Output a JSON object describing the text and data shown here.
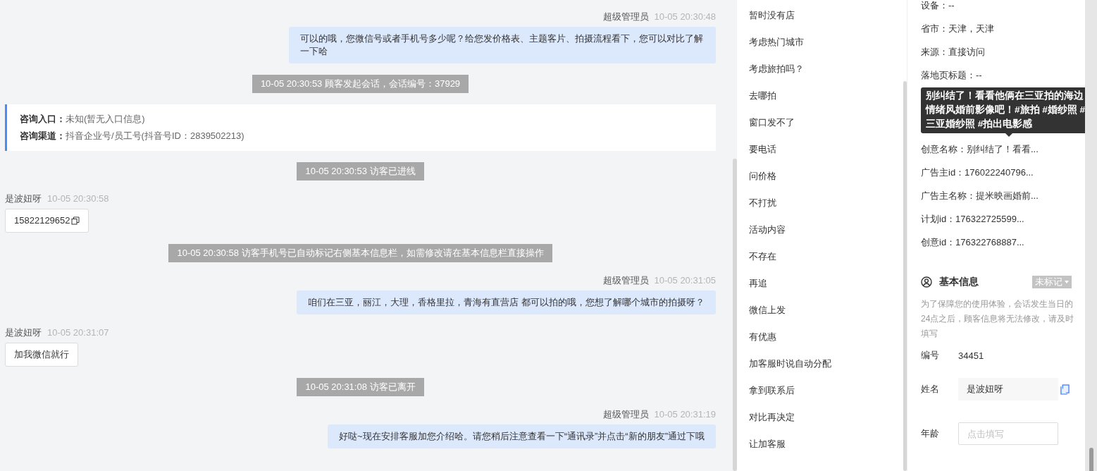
{
  "chat": {
    "messages": [
      {
        "kind": "agent",
        "sender": "超级管理员",
        "time": "10-05 20:30:48",
        "text": "可以的哦，您微信号或者手机号多少呢？给您发价格表、主题客片、拍摄流程看下，您可以对比了解一下哈"
      },
      {
        "kind": "system",
        "text": "10-05 20:30:53 顾客发起会话，会话编号：37929"
      },
      {
        "kind": "info",
        "rows": [
          "**咨询入口：**未知(暂无入口信息)",
          "**咨询渠道：**抖音企业号/员工号(抖音号ID：2839502213)"
        ]
      },
      {
        "kind": "system",
        "text": "10-05 20:30:53 访客已进线"
      },
      {
        "kind": "visitor",
        "sender": "是波妞呀",
        "time": "10-05 20:30:58",
        "text": "15822129652",
        "copyable": true
      },
      {
        "kind": "system",
        "text": "10-05 20:30:58 访客手机号已自动标记右侧基本信息栏，如需修改请在基本信息栏直接操作"
      },
      {
        "kind": "agent",
        "sender": "超级管理员",
        "time": "10-05 20:31:05",
        "text": "咱们在三亚，丽江，大理，香格里拉，青海有直营店 都可以拍的哦，您想了解哪个城市的拍摄呀？"
      },
      {
        "kind": "visitor",
        "sender": "是波妞呀",
        "time": "10-05 20:31:07",
        "text": "加我微信就行",
        "copyable": false
      },
      {
        "kind": "system",
        "text": "10-05 20:31:08 访客已离开"
      },
      {
        "kind": "agent",
        "sender": "超级管理员",
        "time": "10-05 20:31:19",
        "text": "好哒~现在安排客服加您介绍哈。请您稍后注意查看一下“通讯录”并点击“新的朋友”通过下哦"
      }
    ]
  },
  "quick_replies": [
    "暂时没有店",
    "考虑热门城市",
    "考虑旅拍吗？",
    "去哪拍",
    "窗口发不了",
    "要电话",
    "问价格",
    "不打扰",
    "活动内容",
    "不存在",
    "再追",
    "微信上发",
    "有优惠",
    "加客服时说自动分配",
    "拿到联系后",
    "对比再决定",
    "让加客服"
  ],
  "source_info": {
    "rows_above": [
      "设备：--",
      "省市：天津，天津",
      "来源：直接访问",
      "落地页标题：--"
    ],
    "tooltip": "别纠结了！看看他俩在三亚拍的海边情绪风婚前影像吧！#旅拍 #婚纱照 #三亚婚纱照 #拍出电影感",
    "rows_below": [
      "创意名称：别纠结了！看看...",
      "广告主id：176022240796...",
      "广告主名称：提米映画婚前...",
      "计划id：176322725599...",
      "创意id：176322768887..."
    ]
  },
  "basic_info": {
    "title": "基本信息",
    "tag": "未标记",
    "hint": "为了保障您的使用体验，会话发生当日的24点之后，顾客信息将无法修改，请及时填写",
    "fields": [
      {
        "kind": "text",
        "label": "编号",
        "value": "34451"
      },
      {
        "kind": "readonly",
        "label": "姓名",
        "value": "是波妞呀"
      },
      {
        "kind": "input",
        "label": "年龄",
        "placeholder": "点击填写"
      }
    ]
  }
}
